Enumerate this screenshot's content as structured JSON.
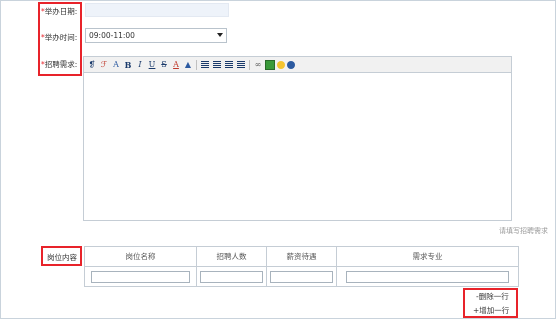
{
  "form": {
    "date_label": "举办日期:",
    "time_label": "举办时间:",
    "req_label": "招聘需求:",
    "required_mark": "*",
    "time_value": "09:00-11:00",
    "editor_hint": "请填写招聘需求"
  },
  "positions": {
    "section_label": "岗位内容",
    "headers": [
      "岗位名称",
      "招聘人数",
      "薪资待遇",
      "需求专业"
    ],
    "delete_row": "-删除一行",
    "add_row": "+增加一行"
  },
  "colors": {
    "highlight": "#e8232a",
    "border": "#c5cdd5",
    "date_bg": "#eef3fa"
  }
}
